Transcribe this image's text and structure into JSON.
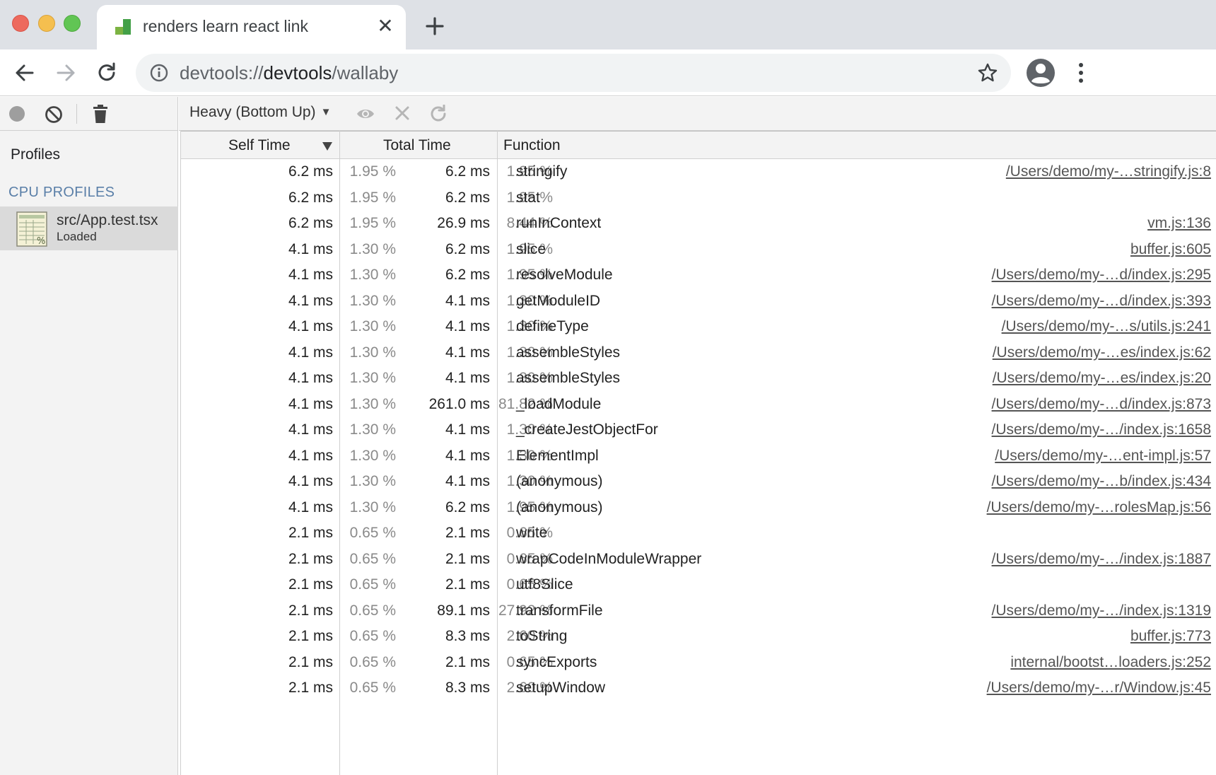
{
  "browser": {
    "tab_title": "renders learn react link",
    "tab_close_glyph": "✕",
    "url_scheme": "devtools://",
    "url_host": "devtools",
    "url_path": "/wallaby",
    "icons": [
      "back-icon",
      "forward-icon",
      "reload-icon",
      "info-icon",
      "star-icon",
      "profile-icon",
      "kebab-menu-icon",
      "new-tab-icon"
    ]
  },
  "sidebar": {
    "heading": "Profiles",
    "section": "CPU PROFILES",
    "profile_name": "src/App.test.tsx",
    "profile_status": "Loaded"
  },
  "toolbar": {
    "view_mode": "Heavy (Bottom Up)",
    "caret": "▼"
  },
  "grid": {
    "headers": {
      "self_time": "Self Time",
      "total_time": "Total Time",
      "function": "Function"
    },
    "rows": [
      {
        "self": "6.2 ms",
        "self_pct": "1.95 %",
        "total": "6.2 ms",
        "total_pct": "1.95 %",
        "function": "stringify",
        "url": "/Users/demo/my-…stringify.js:8"
      },
      {
        "self": "6.2 ms",
        "self_pct": "1.95 %",
        "total": "6.2 ms",
        "total_pct": "1.95 %",
        "function": "stat",
        "url": ""
      },
      {
        "self": "6.2 ms",
        "self_pct": "1.95 %",
        "total": "26.9 ms",
        "total_pct": "8.44 %",
        "function": "runInContext",
        "url": "vm.js:136"
      },
      {
        "self": "4.1 ms",
        "self_pct": "1.30 %",
        "total": "6.2 ms",
        "total_pct": "1.95 %",
        "function": "slice",
        "url": "buffer.js:605"
      },
      {
        "self": "4.1 ms",
        "self_pct": "1.30 %",
        "total": "6.2 ms",
        "total_pct": "1.95 %",
        "function": "resolveModule",
        "url": "/Users/demo/my-…d/index.js:295"
      },
      {
        "self": "4.1 ms",
        "self_pct": "1.30 %",
        "total": "4.1 ms",
        "total_pct": "1.30 %",
        "function": "getModuleID",
        "url": "/Users/demo/my-…d/index.js:393"
      },
      {
        "self": "4.1 ms",
        "self_pct": "1.30 %",
        "total": "4.1 ms",
        "total_pct": "1.30 %",
        "function": "defineType",
        "url": "/Users/demo/my-…s/utils.js:241"
      },
      {
        "self": "4.1 ms",
        "self_pct": "1.30 %",
        "total": "4.1 ms",
        "total_pct": "1.30 %",
        "function": "assembleStyles",
        "url": "/Users/demo/my-…es/index.js:62"
      },
      {
        "self": "4.1 ms",
        "self_pct": "1.30 %",
        "total": "4.1 ms",
        "total_pct": "1.30 %",
        "function": "assembleStyles",
        "url": "/Users/demo/my-…es/index.js:20"
      },
      {
        "self": "4.1 ms",
        "self_pct": "1.30 %",
        "total": "261.0 ms",
        "total_pct": "81.82 %",
        "function": "_loadModule",
        "url": "/Users/demo/my-…d/index.js:873"
      },
      {
        "self": "4.1 ms",
        "self_pct": "1.30 %",
        "total": "4.1 ms",
        "total_pct": "1.30 %",
        "function": "_createJestObjectFor",
        "url": "/Users/demo/my-…/index.js:1658"
      },
      {
        "self": "4.1 ms",
        "self_pct": "1.30 %",
        "total": "4.1 ms",
        "total_pct": "1.30 %",
        "function": "ElementImpl",
        "url": "/Users/demo/my-…ent-impl.js:57"
      },
      {
        "self": "4.1 ms",
        "self_pct": "1.30 %",
        "total": "4.1 ms",
        "total_pct": "1.30 %",
        "function": "(anonymous)",
        "url": "/Users/demo/my-…b/index.js:434"
      },
      {
        "self": "4.1 ms",
        "self_pct": "1.30 %",
        "total": "6.2 ms",
        "total_pct": "1.95 %",
        "function": "(anonymous)",
        "url": "/Users/demo/my-…rolesMap.js:56"
      },
      {
        "self": "2.1 ms",
        "self_pct": "0.65 %",
        "total": "2.1 ms",
        "total_pct": "0.65 %",
        "function": "write",
        "url": ""
      },
      {
        "self": "2.1 ms",
        "self_pct": "0.65 %",
        "total": "2.1 ms",
        "total_pct": "0.65 %",
        "function": "wrapCodeInModuleWrapper",
        "url": "/Users/demo/my-…/index.js:1887"
      },
      {
        "self": "2.1 ms",
        "self_pct": "0.65 %",
        "total": "2.1 ms",
        "total_pct": "0.65 %",
        "function": "utf8Slice",
        "url": ""
      },
      {
        "self": "2.1 ms",
        "self_pct": "0.65 %",
        "total": "89.1 ms",
        "total_pct": "27.92 %",
        "function": "transformFile",
        "url": "/Users/demo/my-…/index.js:1319"
      },
      {
        "self": "2.1 ms",
        "self_pct": "0.65 %",
        "total": "8.3 ms",
        "total_pct": "2.60 %",
        "function": "toString",
        "url": "buffer.js:773"
      },
      {
        "self": "2.1 ms",
        "self_pct": "0.65 %",
        "total": "2.1 ms",
        "total_pct": "0.65 %",
        "function": "syncExports",
        "url": "internal/bootst…loaders.js:252"
      },
      {
        "self": "2.1 ms",
        "self_pct": "0.65 %",
        "total": "8.3 ms",
        "total_pct": "2.60 %",
        "function": "setupWindow",
        "url": "/Users/demo/my-…r/Window.js:45"
      }
    ]
  }
}
